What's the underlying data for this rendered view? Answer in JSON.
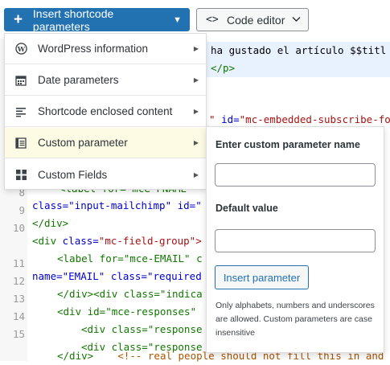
{
  "toolbar": {
    "insert_label": "Insert shortcode parameters",
    "code_editor_label": "Code editor"
  },
  "menu": {
    "items": [
      {
        "icon": "wordpress-icon",
        "label": "WordPress information"
      },
      {
        "icon": "calendar-icon",
        "label": "Date parameters"
      },
      {
        "icon": "enclosed-content-icon",
        "label": "Shortcode enclosed content"
      },
      {
        "icon": "custom-parameter-icon",
        "label": "Custom parameter"
      },
      {
        "icon": "custom-fields-icon",
        "label": "Custom Fields"
      }
    ]
  },
  "custom_parameter_panel": {
    "name_heading": "Enter custom parameter name",
    "name_value": "",
    "default_heading": "Default value",
    "default_value": "",
    "insert_button": "Insert parameter",
    "note": "Only alphabets, numbers and underscores are allowed. Custom parameters are case insensitive"
  },
  "editor": {
    "line_numbers": [
      "",
      "",
      "",
      "",
      "",
      "",
      "",
      "",
      "8",
      "9",
      "10",
      "",
      "11",
      "12",
      "13",
      "14",
      "15"
    ],
    "line1_text": "ha gustado el artículo $$titl",
    "line2_tag": "</p>",
    "line4_a": "\"",
    "line4_attr": "id=",
    "line4_str": "\"mc-embedded-subscribe-fo",
    "line7_a": "<label for=\"mce-FNAME\"",
    "line7b": "class=\"input-mailchimp\" id=\"",
    "line8": "</div>",
    "line9_tag": "<div",
    "line9_attr": "class=",
    "line9_str": "\"mc-field-group\">",
    "line10": "<label for=\"mce-EMAIL\" c",
    "line10b": "name=\"EMAIL\" class=\"required",
    "line11": "</div><div class=\"indica",
    "line12": "<div id=\"mce-responses\"",
    "line13": "<div class=\"response",
    "line14": "<div class=\"response",
    "line15_tag": "</div>",
    "line15_cmt": "<!-- real people should not fill this in and"
  }
}
